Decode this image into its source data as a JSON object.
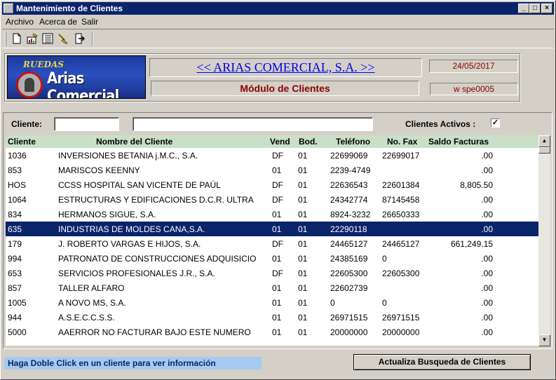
{
  "window": {
    "title": "Mantenimiento de Clientes",
    "minimize_glyph": "_",
    "maximize_glyph": "□",
    "close_glyph": "×"
  },
  "menu": [
    {
      "label": "Archivo"
    },
    {
      "label": "Acerca de"
    },
    {
      "label": "Salir"
    }
  ],
  "toolbar": {
    "icons": [
      "new-document-icon",
      "edit-chart-icon",
      "list-view-icon",
      "clear-icon",
      "exit-door-icon"
    ]
  },
  "header": {
    "logo_tagline": "RUEDAS",
    "logo_name": "Arias Comercial",
    "company_link": "<< ARIAS COMERCIAL, S.A. >>",
    "module_title": "Módulo de Clientes",
    "date": "24/05/2017",
    "user": "w  spe0005"
  },
  "filter": {
    "client_label": "Cliente:",
    "client_code_value": "",
    "client_name_value": "",
    "active_label": "Clientes Activos :",
    "active_checked": "✓"
  },
  "grid": {
    "columns": {
      "code": "Cliente",
      "name": "Nombre del Cliente",
      "vend": "Vend",
      "bod": "Bod.",
      "tel": "Teléfono",
      "fax": "No. Fax",
      "saldo": "Saldo Facturas"
    },
    "rows": [
      {
        "code": "1036",
        "name": " INVERSIONES BETANIA j.M.C., S.A.",
        "vend": "DF",
        "bod": "01",
        "tel": "22699069",
        "fax": "22699017",
        "saldo": ".00"
      },
      {
        "code": "853",
        "name": " MARISCOS KEENNY",
        "vend": "01",
        "bod": "01",
        "tel": "2239-4749",
        "fax": "",
        "saldo": ".00"
      },
      {
        "code": "HOS",
        "name": "CCSS HOSPITAL SAN VICENTE DE PAÚL",
        "vend": "DF",
        "bod": "01",
        "tel": "22636543",
        "fax": "22601384",
        "saldo": "8,805.50"
      },
      {
        "code": "1064",
        "name": "ESTRUCTURAS Y EDIFICACIONES D.C.R. ULTRA",
        "vend": "DF",
        "bod": "01",
        "tel": "24342774",
        "fax": "87145458",
        "saldo": ".00"
      },
      {
        "code": "834",
        "name": "HERMANOS SIGUE, S.A.",
        "vend": "01",
        "bod": "01",
        "tel": "8924-3232",
        "fax": "26650333",
        "saldo": ".00"
      },
      {
        "code": "635",
        "name": "INDUSTRIAS DE MOLDES CANA,S.A.",
        "vend": "01",
        "bod": "01",
        "tel": "22290118",
        "fax": "",
        "saldo": ".00",
        "selected": true
      },
      {
        "code": "179",
        "name": "J. ROBERTO VARGAS E HIJOS, S.A.",
        "vend": "DF",
        "bod": "01",
        "tel": "24465127",
        "fax": "24465127",
        "saldo": "661,249.15"
      },
      {
        "code": "994",
        "name": "PATRONATO DE CONSTRUCCIONES ADQUISICIO",
        "vend": "01",
        "bod": "01",
        "tel": "24385169",
        "fax": "0",
        "saldo": ".00"
      },
      {
        "code": "653",
        "name": "SERVICIOS PROFESIONALES  J.R., S.A.",
        "vend": "DF",
        "bod": "01",
        "tel": "22605300",
        "fax": "22605300",
        "saldo": ".00"
      },
      {
        "code": "857",
        "name": "TALLER ALFARO",
        "vend": "01",
        "bod": "01",
        "tel": "22602739",
        "fax": "",
        "saldo": ".00"
      },
      {
        "code": "1005",
        "name": "A NOVO MS, S.A.",
        "vend": "01",
        "bod": "01",
        "tel": "0",
        "fax": "0",
        "saldo": ".00"
      },
      {
        "code": "944",
        "name": "A.S.E.C.C.S.S.",
        "vend": "01",
        "bod": "01",
        "tel": "26971515",
        "fax": "26971515",
        "saldo": ".00"
      },
      {
        "code": "5000",
        "name": "AAERROR NO FACTURAR BAJO ESTE NUMERO",
        "vend": "01",
        "bod": "01",
        "tel": "20000000",
        "fax": "20000000",
        "saldo": ".00"
      }
    ]
  },
  "footer": {
    "hint": "Haga Doble Click en un cliente para ver información",
    "refresh_button": "Actualiza Busqueda de Clientes"
  }
}
